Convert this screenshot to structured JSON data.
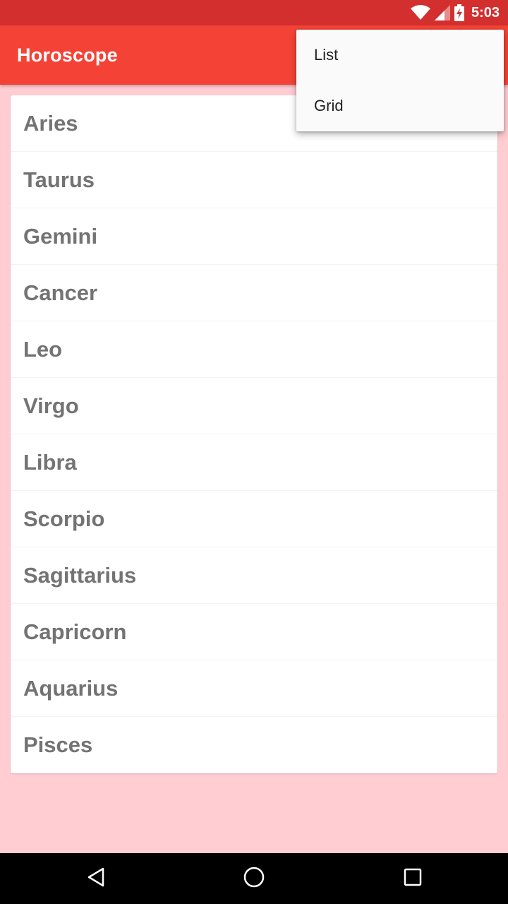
{
  "status_bar": {
    "time": "5:03",
    "icons": [
      "wifi-icon",
      "signal-icon",
      "battery-charging-icon"
    ]
  },
  "app_bar": {
    "title": "Horoscope",
    "background_color": "#f44336"
  },
  "overflow_menu": {
    "items": [
      {
        "label": "List"
      },
      {
        "label": "Grid"
      }
    ]
  },
  "list": {
    "items": [
      {
        "label": "Aries"
      },
      {
        "label": "Taurus"
      },
      {
        "label": "Gemini"
      },
      {
        "label": "Cancer"
      },
      {
        "label": "Leo"
      },
      {
        "label": "Virgo"
      },
      {
        "label": "Libra"
      },
      {
        "label": "Scorpio"
      },
      {
        "label": "Sagittarius"
      },
      {
        "label": "Capricorn"
      },
      {
        "label": "Aquarius"
      },
      {
        "label": "Pisces"
      }
    ]
  },
  "nav_bar": {
    "buttons": [
      "back-icon",
      "home-icon",
      "recents-icon"
    ]
  },
  "colors": {
    "status_bar": "#d32f2f",
    "app_bar": "#f44336",
    "page_background": "#ffcdd2",
    "list_text": "#737373"
  }
}
